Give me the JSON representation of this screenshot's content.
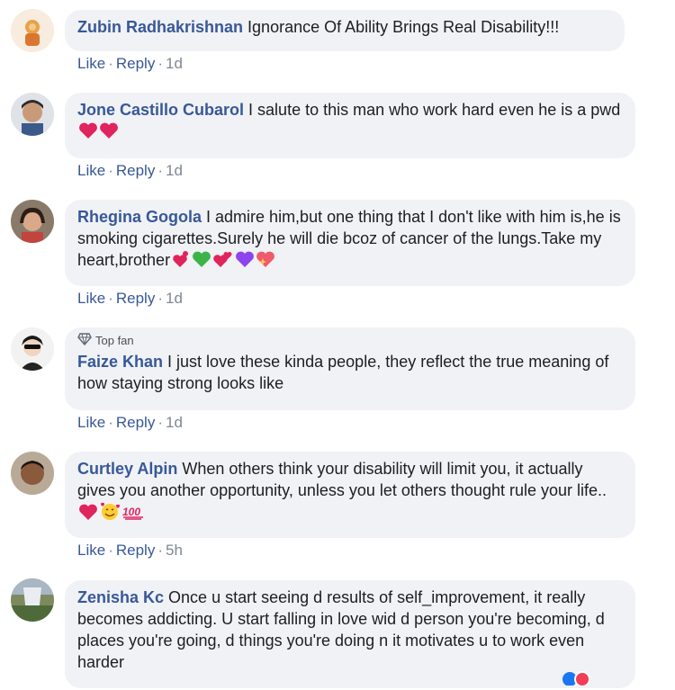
{
  "comments": [
    {
      "author": "Zubin Radhakrishnan",
      "text": "Ignorance Of Ability Brings Real Disability!!!",
      "like": "Like",
      "reply": "Reply",
      "time": "1d"
    },
    {
      "author": "Jone Castillo Cubarol",
      "text": "I salute to this man who work hard even he is a pwd",
      "emojis": [
        "red-heart",
        "red-heart"
      ],
      "like": "Like",
      "reply": "Reply",
      "time": "1d"
    },
    {
      "author": "Rhegina Gogola",
      "text": "I admire him,but one thing that I don't like with him is,he is smoking cigarettes.Surely he will die bcoz of cancer of the lungs.Take my heart,brother",
      "emojis": [
        "heart-exclamation",
        "green-heart",
        "two-hearts",
        "purple-heart",
        "sparkling-heart"
      ],
      "like": "Like",
      "reply": "Reply",
      "time": "1d"
    },
    {
      "badge": "Top fan",
      "author": "Faize Khan",
      "text": "I just love these kinda people, they reflect the true meaning of how staying strong looks like",
      "like": "Like",
      "reply": "Reply",
      "time": "1d"
    },
    {
      "author": "Curtley Alpin",
      "text": "When others think your disability will limit you, it actually gives you another opportunity, unless you let others thought rule your life..",
      "emojis": [
        "red-heart",
        "smiling-face-with-hearts",
        "hundred-points"
      ],
      "like": "Like",
      "reply": "Reply",
      "time": "5h"
    },
    {
      "author": "Zenisha Kc",
      "text": "Once u start seeing d results of self_improvement, it really becomes addicting. U start falling in love wid d person you're becoming, d places you're going, d things you're doing n it motivates u to work even harder"
    }
  ],
  "colors": {
    "name": "#385898",
    "bubble": "#f0f2f5",
    "meta": "#7f8794",
    "heart": "#e0245e"
  }
}
